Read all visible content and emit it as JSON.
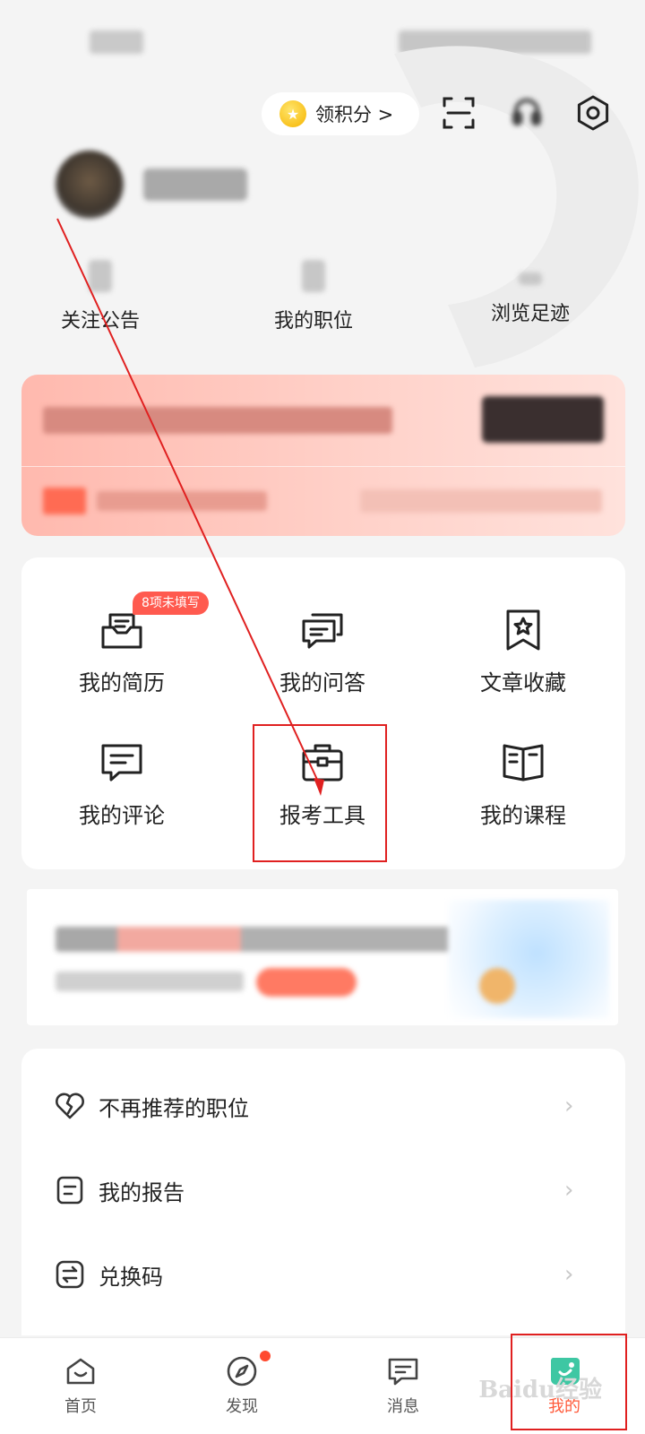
{
  "header": {
    "points_label": "领积分 >"
  },
  "stats": [
    {
      "label": "关注公告"
    },
    {
      "label": "我的职位"
    },
    {
      "label": "浏览足迹"
    }
  ],
  "functions": {
    "badge": "8项未填写",
    "items": [
      {
        "label": "我的简历",
        "icon": "resume-icon"
      },
      {
        "label": "我的问答",
        "icon": "qa-icon"
      },
      {
        "label": "文章收藏",
        "icon": "bookmark-icon"
      },
      {
        "label": "我的评论",
        "icon": "comment-icon"
      },
      {
        "label": "报考工具",
        "icon": "toolbox-icon"
      },
      {
        "label": "我的课程",
        "icon": "book-icon"
      }
    ]
  },
  "list": [
    {
      "label": "不再推荐的职位",
      "icon": "broken-heart-icon"
    },
    {
      "label": "我的报告",
      "icon": "report-icon"
    },
    {
      "label": "兑换码",
      "icon": "exchange-icon"
    }
  ],
  "nav": [
    {
      "label": "首页",
      "icon": "home-icon"
    },
    {
      "label": "发现",
      "icon": "compass-icon"
    },
    {
      "label": "消息",
      "icon": "message-icon"
    },
    {
      "label": "我的",
      "icon": "profile-icon"
    }
  ],
  "colors": {
    "accent": "#ff5a3a",
    "annotation": "#e02020",
    "badge": "#ff5a4f"
  },
  "watermark": "Baidu经验"
}
